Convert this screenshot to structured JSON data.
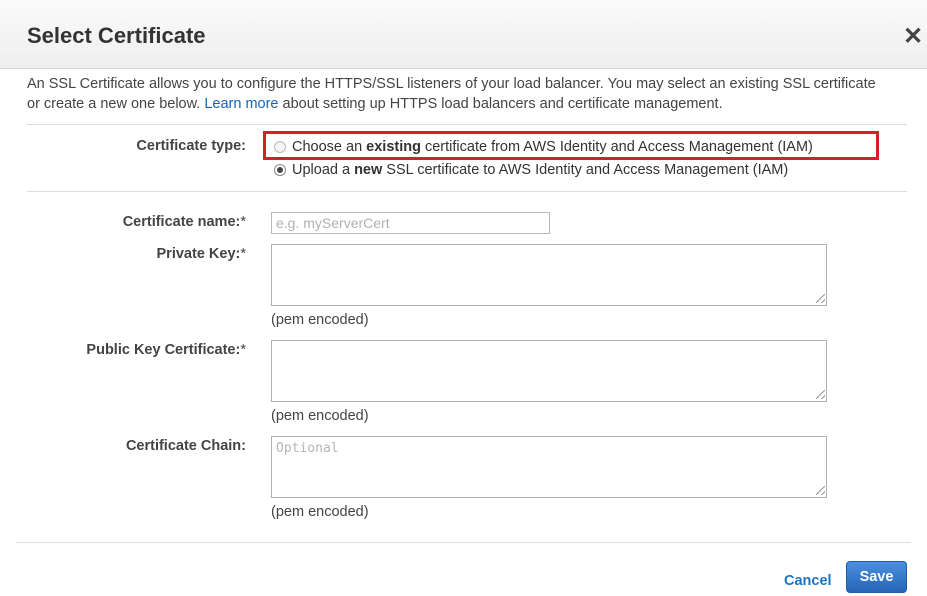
{
  "dialog": {
    "title": "Select Certificate",
    "close_glyph": "✕"
  },
  "intro": {
    "text_before_link": "An SSL Certificate allows you to configure the HTTPS/SSL listeners of your load balancer. You may select an existing SSL certificate or create a new one below. ",
    "link_text": "Learn more",
    "text_after_link": " about setting up HTTPS load balancers and certificate management."
  },
  "certificate_type": {
    "label": "Certificate type:",
    "options": [
      {
        "prefix": "Choose an ",
        "bold": "existing",
        "suffix": " certificate from AWS Identity and Access Management (IAM)",
        "selected": false
      },
      {
        "prefix": "Upload a ",
        "bold": "new",
        "suffix": " SSL certificate to AWS Identity and Access Management (IAM)",
        "selected": true
      }
    ]
  },
  "form": {
    "certificate_name": {
      "label": "Certificate name:",
      "required_mark": "*",
      "placeholder": "e.g. myServerCert",
      "value": ""
    },
    "private_key": {
      "label": "Private Key:",
      "required_mark": "*",
      "placeholder": "",
      "hint": "(pem encoded)"
    },
    "public_key_certificate": {
      "label": "Public Key Certificate:",
      "required_mark": "*",
      "placeholder": "",
      "hint": "(pem encoded)"
    },
    "certificate_chain": {
      "label": "Certificate Chain:",
      "placeholder": "Optional",
      "hint": "(pem encoded)"
    }
  },
  "footer": {
    "cancel_label": "Cancel",
    "save_label": "Save"
  },
  "colors": {
    "highlight_border": "#d42026",
    "link": "#1166bb",
    "primary_button": "#2565b5"
  }
}
